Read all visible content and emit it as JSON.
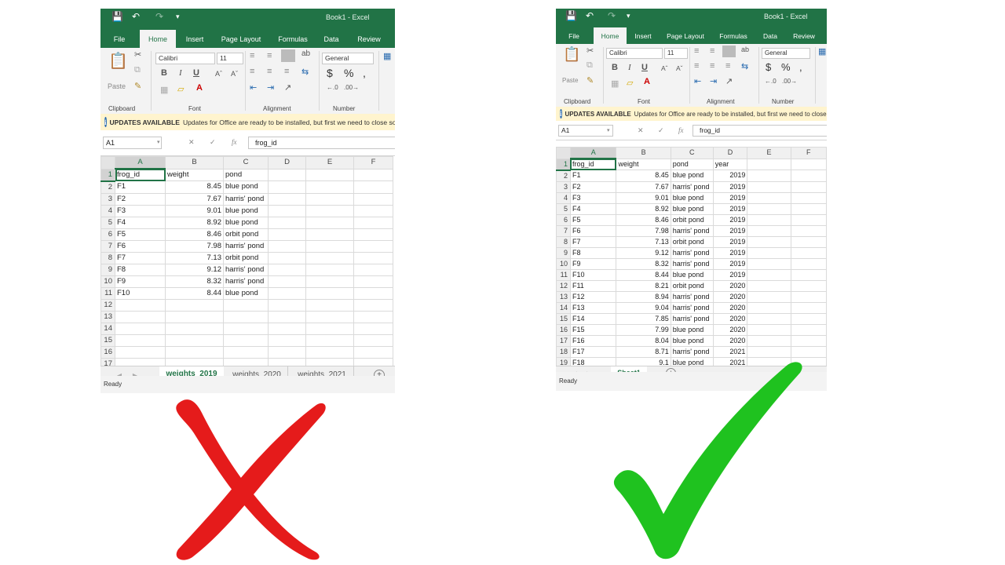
{
  "colors": {
    "excel_green": "#217346",
    "cross_red": "#e51b1b",
    "check_green": "#1fc21f",
    "message_yellow": "#fff4ce"
  },
  "common": {
    "ribbon_tabs": [
      "File",
      "Home",
      "Insert",
      "Page Layout",
      "Formulas",
      "Data",
      "Review"
    ],
    "active_tab": "Home",
    "font_name": "Calibri",
    "font_size": "11",
    "number_format": "General",
    "paste_label": "Paste",
    "groups": {
      "clipboard": "Clipboard",
      "font": "Font",
      "alignment": "Alignment",
      "number": "Number"
    },
    "updates_title": "UPDATES AVAILABLE",
    "updates_text": "Updates for Office are ready to be installed, but first we need to close some apps.",
    "name_box": "A1",
    "formula_value": "frog_id",
    "fx_label": "fx",
    "status": "Ready"
  },
  "left_window": {
    "title": "Book1  -  Excel",
    "columns": [
      "A",
      "B",
      "C",
      "D",
      "E",
      "F"
    ],
    "rows": [
      [
        "frog_id",
        "weight",
        "pond"
      ],
      [
        "F1",
        "8.45",
        "blue pond"
      ],
      [
        "F2",
        "7.67",
        "harris' pond"
      ],
      [
        "F3",
        "9.01",
        "blue pond"
      ],
      [
        "F4",
        "8.92",
        "blue pond"
      ],
      [
        "F5",
        "8.46",
        "orbit pond"
      ],
      [
        "F6",
        "7.98",
        "harris' pond"
      ],
      [
        "F7",
        "7.13",
        "orbit pond"
      ],
      [
        "F8",
        "9.12",
        "harris' pond"
      ],
      [
        "F9",
        "8.32",
        "harris' pond"
      ],
      [
        "F10",
        "8.44",
        "blue pond"
      ],
      [],
      [],
      [],
      [],
      [],
      []
    ],
    "sheet_tabs": [
      "weights_2019",
      "weights_2020",
      "weights_2021"
    ],
    "active_sheet": "weights_2019",
    "verdict": "cross-mark-incorrect"
  },
  "right_window": {
    "title": "Book1  -  Excel",
    "columns": [
      "A",
      "B",
      "C",
      "D",
      "E",
      "F"
    ],
    "rows": [
      [
        "frog_id",
        "weight",
        "pond",
        "year"
      ],
      [
        "F1",
        "8.45",
        "blue pond",
        "2019"
      ],
      [
        "F2",
        "7.67",
        "harris' pond",
        "2019"
      ],
      [
        "F3",
        "9.01",
        "blue pond",
        "2019"
      ],
      [
        "F4",
        "8.92",
        "blue pond",
        "2019"
      ],
      [
        "F5",
        "8.46",
        "orbit pond",
        "2019"
      ],
      [
        "F6",
        "7.98",
        "harris' pond",
        "2019"
      ],
      [
        "F7",
        "7.13",
        "orbit pond",
        "2019"
      ],
      [
        "F8",
        "9.12",
        "harris' pond",
        "2019"
      ],
      [
        "F9",
        "8.32",
        "harris' pond",
        "2019"
      ],
      [
        "F10",
        "8.44",
        "blue pond",
        "2019"
      ],
      [
        "F11",
        "8.21",
        "orbit pond",
        "2020"
      ],
      [
        "F12",
        "8.94",
        "harris' pond",
        "2020"
      ],
      [
        "F13",
        "9.04",
        "harris' pond",
        "2020"
      ],
      [
        "F14",
        "7.85",
        "harris' pond",
        "2020"
      ],
      [
        "F15",
        "7.99",
        "blue pond",
        "2020"
      ],
      [
        "F16",
        "8.04",
        "blue pond",
        "2020"
      ],
      [
        "F17",
        "8.71",
        "harris' pond",
        "2021"
      ],
      [
        "F18",
        "9.1",
        "blue pond",
        "2021"
      ]
    ],
    "sheet_tabs": [
      "Sheet1"
    ],
    "active_sheet": "Sheet1",
    "verdict": "check-mark-correct"
  }
}
